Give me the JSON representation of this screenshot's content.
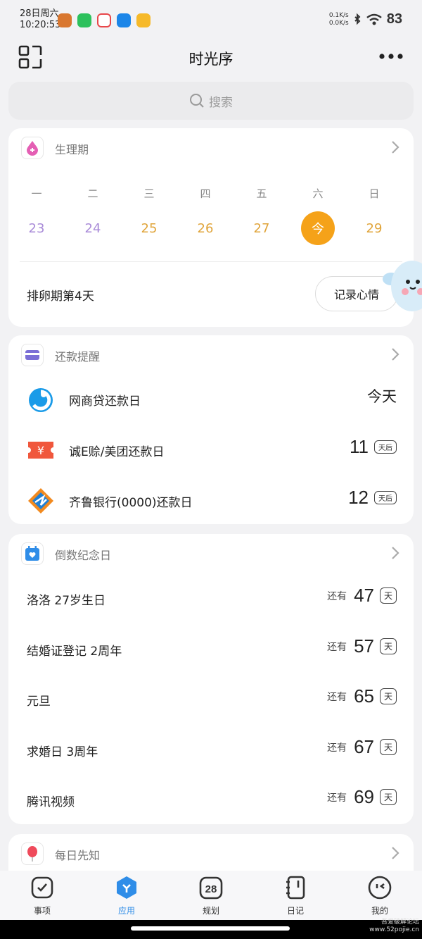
{
  "status_bar": {
    "date": "28日周六",
    "time": "10:20:53",
    "net_up": "0.1K/s",
    "net_down": "0.0K/s",
    "battery": "83",
    "app_icons": [
      "tiger-app-icon",
      "wechat-icon",
      "red-app-icon",
      "blue-robot-app-icon",
      "yellow-app-icon"
    ]
  },
  "header": {
    "title": "时光序"
  },
  "search": {
    "placeholder": "搜索"
  },
  "period": {
    "title": "生理期",
    "weekdays": [
      "一",
      "二",
      "三",
      "四",
      "五",
      "六",
      "日"
    ],
    "dates": [
      "23",
      "24",
      "25",
      "26",
      "27",
      "今",
      "29"
    ],
    "status": "排卵期第4天",
    "mood_button": "记录心情",
    "colors": {
      "past": "#a98bd8",
      "future": "#e0a43a",
      "today": "#f5a219"
    }
  },
  "repay": {
    "title": "还款提醒",
    "items": [
      {
        "name": "网商贷还款日",
        "value": "今天",
        "tag": ""
      },
      {
        "name": "诚E赊/美团还款日",
        "value": "11",
        "tag": "天后"
      },
      {
        "name": "齐鲁银行(0000)还款日",
        "value": "12",
        "tag": "天后"
      }
    ]
  },
  "countdown": {
    "title": "倒数纪念日",
    "prefix": "还有",
    "unit": "天",
    "items": [
      {
        "name": "洛洛 27岁生日",
        "days": "47"
      },
      {
        "name": "结婚证登记 2周年",
        "days": "57"
      },
      {
        "name": "元旦",
        "days": "65"
      },
      {
        "name": "求婚日 3周年",
        "days": "67"
      },
      {
        "name": "腾讯视频",
        "days": "69"
      }
    ]
  },
  "daily": {
    "title": "每日先知"
  },
  "tabs": [
    {
      "label": "事项",
      "icon": "check-square-icon"
    },
    {
      "label": "应用",
      "icon": "apps-icon",
      "active": true
    },
    {
      "label": "规划",
      "icon": "calendar-28-icon",
      "number": "28"
    },
    {
      "label": "日记",
      "icon": "notebook-icon"
    },
    {
      "label": "我的",
      "icon": "profile-face-icon"
    }
  ],
  "watermark": {
    "line1": "吾爱破解论坛",
    "line2": "www.52pojie.cn"
  },
  "accent_color": "#2f8de8"
}
